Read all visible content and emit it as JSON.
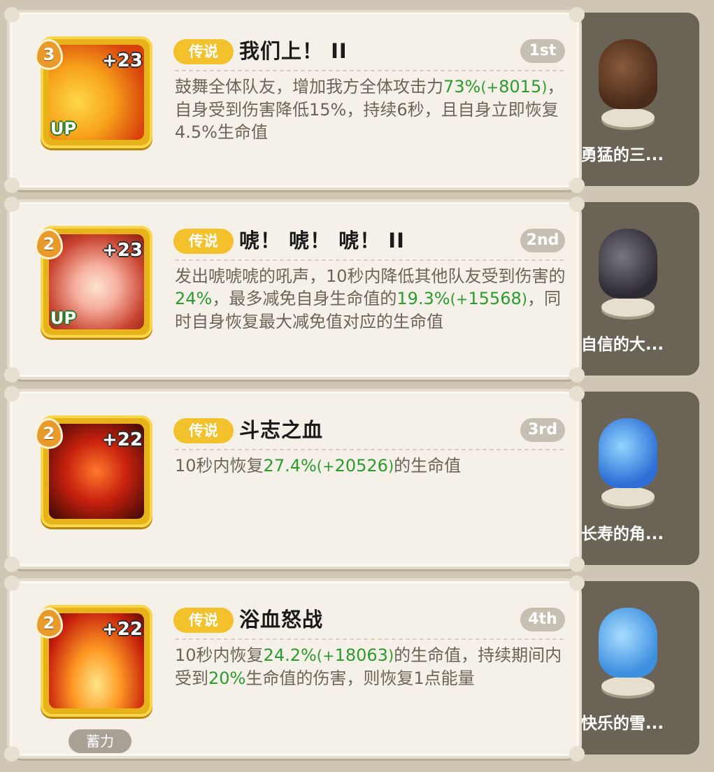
{
  "skills": [
    {
      "level": "3",
      "plus": "+23",
      "up": "UP",
      "tag": "传说",
      "title": "我们上！ II",
      "rank": "1st",
      "desc": [
        {
          "t": "鼓舞全体队友，增加我方全体攻击力"
        },
        {
          "t": "73%",
          "c": "g"
        },
        {
          "t": "(+",
          "c": "gs"
        },
        {
          "t": "8015",
          "c": "g"
        },
        {
          "t": ")",
          "c": "gs"
        },
        {
          "t": "，自身受到伤害降低15%，持续6秒，且自身立即恢复4.5%生命值"
        }
      ],
      "figure_name": "勇猛的三...",
      "charge": ""
    },
    {
      "level": "2",
      "plus": "+23",
      "up": "UP",
      "tag": "传说",
      "title": "唬！ 唬！ 唬！ II",
      "rank": "2nd",
      "desc": [
        {
          "t": "发出唬唬唬的吼声，10秒内降低其他队友受到伤害的"
        },
        {
          "t": "24%",
          "c": "g"
        },
        {
          "t": "，最多减免自身生命值的"
        },
        {
          "t": "19.3%",
          "c": "g"
        },
        {
          "t": "(+",
          "c": "gs"
        },
        {
          "t": "15568",
          "c": "g"
        },
        {
          "t": ")",
          "c": "gs"
        },
        {
          "t": "，同时自身恢复最大减免值对应的生命值"
        }
      ],
      "figure_name": "自信的大...",
      "charge": ""
    },
    {
      "level": "2",
      "plus": "+22",
      "up": "",
      "tag": "传说",
      "title": "斗志之血",
      "rank": "3rd",
      "desc": [
        {
          "t": "10秒内恢复"
        },
        {
          "t": "27.4%",
          "c": "g"
        },
        {
          "t": "(+",
          "c": "gs"
        },
        {
          "t": "20526",
          "c": "g"
        },
        {
          "t": ")",
          "c": "gs"
        },
        {
          "t": "的生命值"
        }
      ],
      "figure_name": "长寿的角...",
      "charge": ""
    },
    {
      "level": "2",
      "plus": "+22",
      "up": "",
      "tag": "传说",
      "title": "浴血怒战",
      "rank": "4th",
      "desc": [
        {
          "t": "10秒内恢复"
        },
        {
          "t": "24.2%",
          "c": "g"
        },
        {
          "t": "(+",
          "c": "gs"
        },
        {
          "t": "18063",
          "c": "g"
        },
        {
          "t": ")",
          "c": "gs"
        },
        {
          "t": "的生命值，持续期间内受到"
        },
        {
          "t": "20%",
          "c": "g"
        },
        {
          "t": "生命值的伤害，则恢复1点能量"
        }
      ],
      "figure_name": "快乐的雪...",
      "charge": "蓄力"
    }
  ]
}
